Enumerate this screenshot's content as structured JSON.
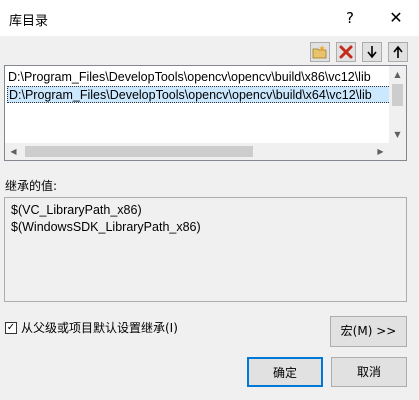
{
  "window": {
    "title": "库目录",
    "help_label": "?",
    "close_label": "✕"
  },
  "toolbar": {
    "new_icon": "new-folder-icon",
    "delete_icon": "delete-x-icon",
    "down_icon": "arrow-down-icon",
    "up_icon": "arrow-up-icon",
    "delete_color": "#c42b1c"
  },
  "directories": {
    "items": [
      "D:\\Program_Files\\DevelopTools\\opencv\\opencv\\build\\x86\\vc12\\lib",
      "D:\\Program_Files\\DevelopTools\\opencv\\opencv\\build\\x64\\vc12\\lib"
    ],
    "selected_index": 1
  },
  "inherited": {
    "label": "继承的值:",
    "values": [
      "$(VC_LibraryPath_x86)",
      "$(WindowsSDK_LibraryPath_x86)"
    ]
  },
  "options": {
    "inherit_label": "从父级或项目默认设置继承(I)",
    "inherit_checked": true,
    "check_mark": "✓"
  },
  "buttons": {
    "macro": "宏(M) >>",
    "ok": "确定",
    "cancel": "取消"
  }
}
